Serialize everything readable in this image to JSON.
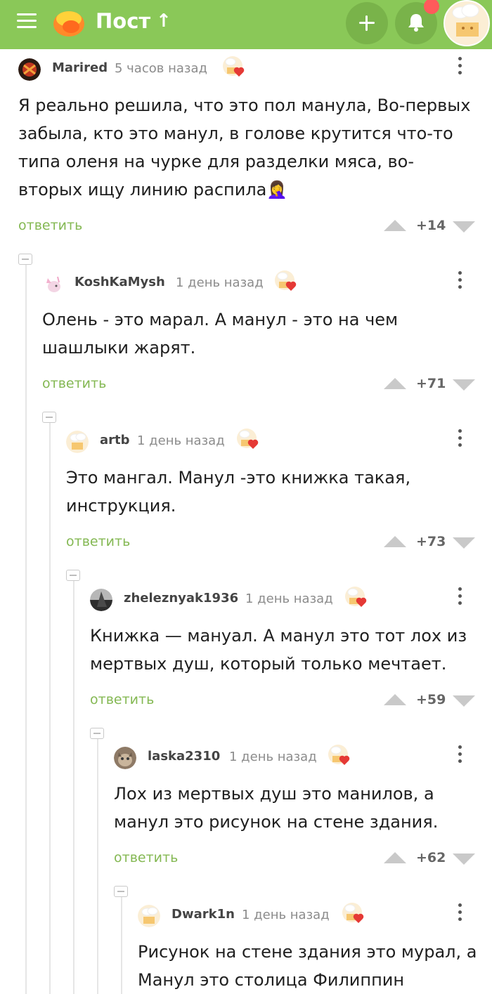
{
  "header": {
    "title": "Пост",
    "colors": {
      "bar": "#8ac858",
      "button": "#79b34a",
      "notification": "#ff5b5b",
      "reply": "#84b853"
    }
  },
  "comments": [
    {
      "user": "Marired",
      "time": "5 часов назад",
      "text": "Я реально решила, что это пол манула, Во-первых забыла, кто это манул, в голове крутится что-то типа оленя на чурке для разделки мяса, во-вторых ищу линию распила🤦‍♀️",
      "reply": "ответить",
      "rating": "+14"
    },
    {
      "user": "KoshKaMysh",
      "time": "1 день назад",
      "text": "Олень - это марал. А манул - это на чем шашлыки жарят.",
      "reply": "ответить",
      "rating": "+71"
    },
    {
      "user": "artb",
      "time": "1 день назад",
      "text": "Это мангал. Манул -это книжка такая, инструкция.",
      "reply": "ответить",
      "rating": "+73"
    },
    {
      "user": "zheleznyak1936",
      "time": "1 день назад",
      "text": "Книжка — мануал. А манул это тот лох из мертвых душ, который только мечтает.",
      "reply": "ответить",
      "rating": "+59"
    },
    {
      "user": "laska2310",
      "time": "1 день назад",
      "text": "Лох из мертвых душ это манилов, а манул это рисунок на стене здания.",
      "reply": "ответить",
      "rating": "+62"
    },
    {
      "user": "Dwark1n",
      "time": "1 день назад",
      "text": "Рисунок на стене здания это мурал, а Манул это столица Филиппин",
      "reply": "",
      "rating": ""
    }
  ]
}
